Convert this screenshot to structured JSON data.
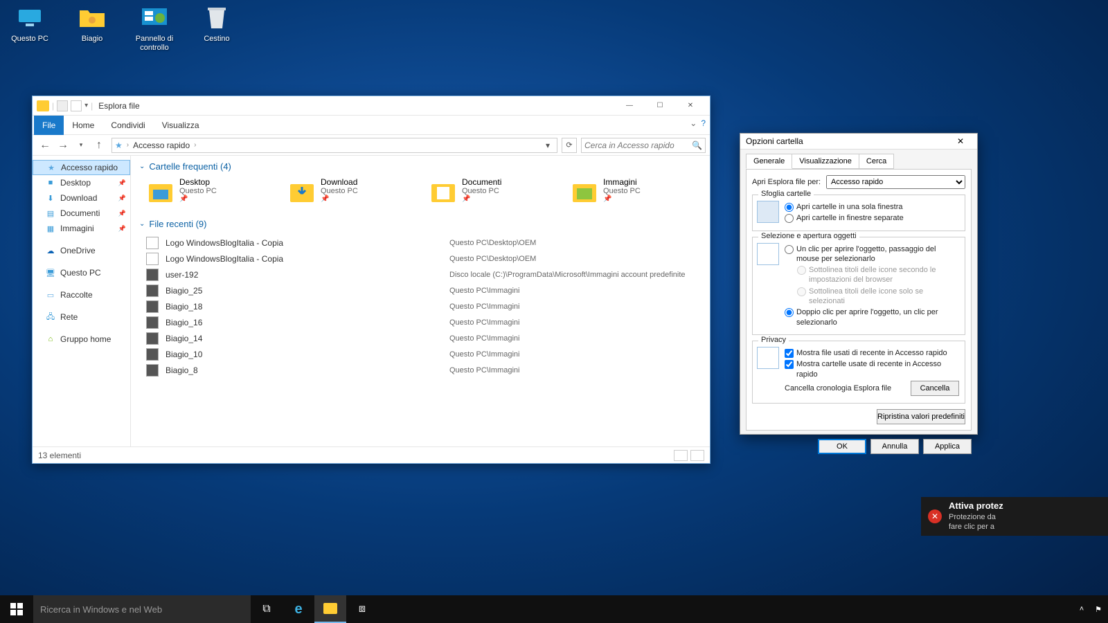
{
  "desktop_icons": [
    {
      "name": "questo-pc-icon",
      "label": "Questo PC"
    },
    {
      "name": "user-folder-icon",
      "label": "Biagio"
    },
    {
      "name": "control-panel-icon",
      "label": "Pannello di controllo"
    },
    {
      "name": "recycle-bin-icon",
      "label": "Cestino"
    }
  ],
  "explorer": {
    "title": "Esplora file",
    "tabs": {
      "file": "File",
      "home": "Home",
      "share": "Condividi",
      "view": "Visualizza"
    },
    "breadcrumb": "Accesso rapido",
    "search_placeholder": "Cerca in Accesso rapido",
    "nav": {
      "quick": "Accesso rapido",
      "desktop": "Desktop",
      "download": "Download",
      "documents": "Documenti",
      "pictures": "Immagini",
      "onedrive": "OneDrive",
      "thispc": "Questo PC",
      "collections": "Raccolte",
      "network": "Rete",
      "homegroup": "Gruppo home"
    },
    "freq_header": "Cartelle frequenti (4)",
    "freq": [
      {
        "name": "Desktop",
        "loc": "Questo PC"
      },
      {
        "name": "Download",
        "loc": "Questo PC"
      },
      {
        "name": "Documenti",
        "loc": "Questo PC"
      },
      {
        "name": "Immagini",
        "loc": "Questo PC"
      }
    ],
    "recent_header": "File recenti (9)",
    "recent": [
      {
        "name": "Logo WindowsBlogItalia - Copia",
        "loc": "Questo PC\\Desktop\\OEM",
        "thumb": "doc"
      },
      {
        "name": "Logo WindowsBlogItalia - Copia",
        "loc": "Questo PC\\Desktop\\OEM",
        "thumb": "doc"
      },
      {
        "name": "user-192",
        "loc": "Disco locale (C:)\\ProgramData\\Microsoft\\Immagini account predefinite",
        "thumb": "img"
      },
      {
        "name": "Biagio_25",
        "loc": "Questo PC\\Immagini",
        "thumb": "img"
      },
      {
        "name": "Biagio_18",
        "loc": "Questo PC\\Immagini",
        "thumb": "img"
      },
      {
        "name": "Biagio_16",
        "loc": "Questo PC\\Immagini",
        "thumb": "img"
      },
      {
        "name": "Biagio_14",
        "loc": "Questo PC\\Immagini",
        "thumb": "img"
      },
      {
        "name": "Biagio_10",
        "loc": "Questo PC\\Immagini",
        "thumb": "img"
      },
      {
        "name": "Biagio_8",
        "loc": "Questo PC\\Immagini",
        "thumb": "img"
      }
    ],
    "status": "13 elementi"
  },
  "dialog": {
    "title": "Opzioni cartella",
    "tabs": {
      "general": "Generale",
      "view": "Visualizzazione",
      "search": "Cerca"
    },
    "open_label": "Apri Esplora file per:",
    "open_value": "Accesso rapido",
    "browse_legend": "Sfoglia cartelle",
    "browse_same": "Apri cartelle in una sola finestra",
    "browse_new": "Apri cartelle in finestre separate",
    "click_legend": "Selezione e apertura oggetti",
    "single_click": "Un clic per aprire l'oggetto, passaggio del mouse per selezionarlo",
    "underline_browser": "Sottolinea titoli delle icone secondo le impostazioni del browser",
    "underline_selected": "Sottolinea titoli delle icone solo se selezionati",
    "double_click": "Doppio clic per aprire l'oggetto, un clic per selezionarlo",
    "privacy_legend": "Privacy",
    "show_files": "Mostra file usati di recente in Accesso rapido",
    "show_folders": "Mostra cartelle usate di recente in Accesso rapido",
    "clear_label": "Cancella cronologia Esplora file",
    "clear_btn": "Cancella",
    "restore_btn": "Ripristina valori predefiniti",
    "ok": "OK",
    "cancel": "Annulla",
    "apply": "Applica"
  },
  "toast": {
    "title": "Attiva protez",
    "line1": "Protezione da",
    "line2": "fare clic per a"
  },
  "taskbar": {
    "search_placeholder": "Ricerca in Windows e nel Web"
  }
}
